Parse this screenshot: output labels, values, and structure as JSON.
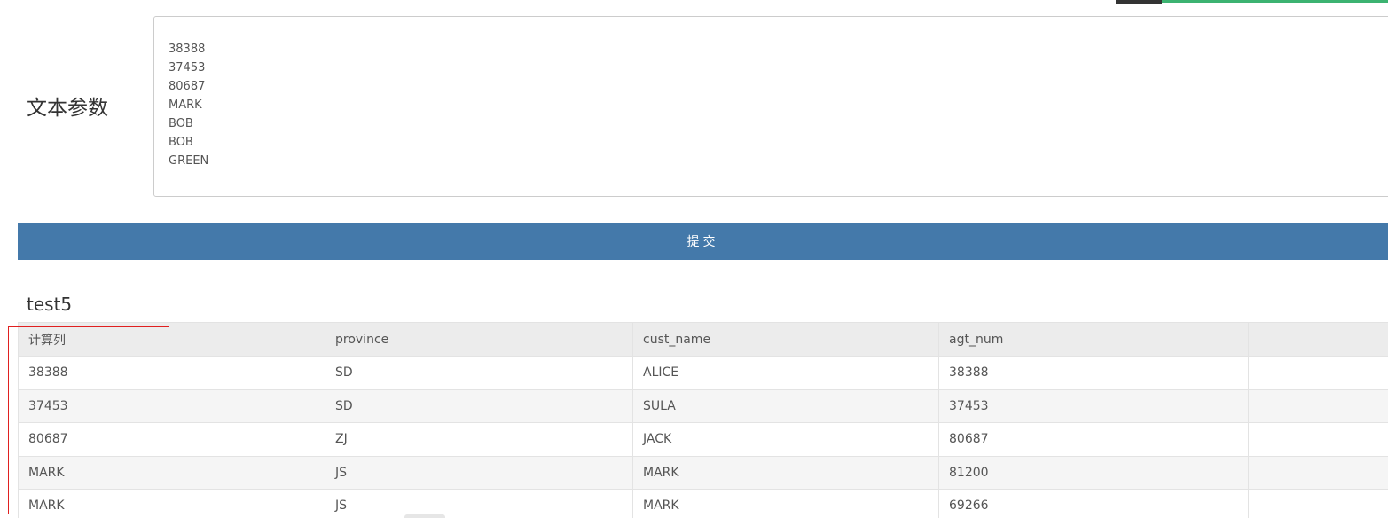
{
  "form": {
    "label": "文本参数",
    "text_lines": [
      "38388",
      "37453",
      "80687",
      "MARK",
      "BOB",
      "BOB",
      "GREEN"
    ],
    "submit_label": "提交"
  },
  "table": {
    "title": "test5",
    "columns": [
      "计算列",
      "province",
      "cust_name",
      "agt_num",
      ""
    ],
    "rows": [
      [
        "38388",
        "SD",
        "ALICE",
        "38388",
        ""
      ],
      [
        "37453",
        "SD",
        "SULA",
        "37453",
        ""
      ],
      [
        "80687",
        "ZJ",
        "JACK",
        "80687",
        ""
      ],
      [
        "MARK",
        "JS",
        "MARK",
        "81200",
        ""
      ],
      [
        "MARK",
        "JS",
        "MARK",
        "69266",
        ""
      ]
    ]
  },
  "colors": {
    "submit_bg": "#4479aa",
    "highlight_border": "#e02020",
    "header_bg": "#ececec"
  }
}
